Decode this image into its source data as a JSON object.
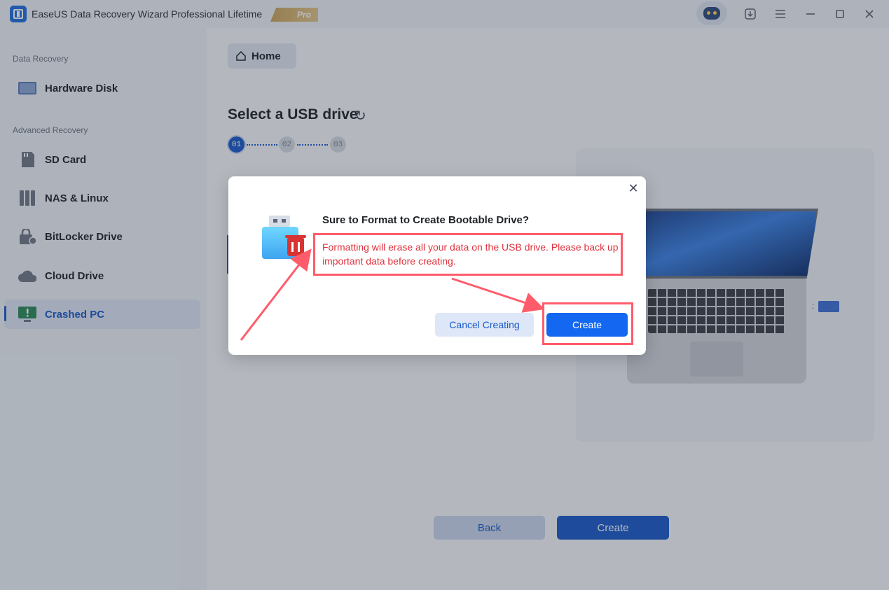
{
  "window": {
    "app_title": "EaseUS Data Recovery Wizard Professional Lifetime",
    "badge": "Pro"
  },
  "sidebar": {
    "sections": [
      {
        "label": "Data Recovery"
      },
      {
        "label": "Advanced Recovery"
      }
    ],
    "items": [
      {
        "label": "Hardware Disk",
        "icon": "hard-disk-icon"
      },
      {
        "label": "SD Card",
        "icon": "sd-card-icon"
      },
      {
        "label": "NAS & Linux",
        "icon": "nas-icon"
      },
      {
        "label": "BitLocker Drive",
        "icon": "bitlocker-icon"
      },
      {
        "label": "Cloud Drive",
        "icon": "cloud-icon"
      },
      {
        "label": "Crashed PC",
        "icon": "crashed-pc-icon",
        "active": true
      }
    ]
  },
  "main": {
    "home_label": "Home",
    "page_title": "Select a USB drive",
    "steps": [
      "01",
      "02",
      "03"
    ],
    "current_step": 1,
    "back_label": "Back",
    "create_label": "Create"
  },
  "dialog": {
    "title": "Sure to Format to Create Bootable Drive?",
    "message": "Formatting will erase all your data on the USB drive. Please back up important data before creating.",
    "cancel_label": "Cancel Creating",
    "create_label": "Create"
  },
  "colors": {
    "accent": "#1a59c9",
    "primary_button": "#1467f0",
    "warning_text": "#e0323c",
    "annotation": "#ff5c6b"
  }
}
